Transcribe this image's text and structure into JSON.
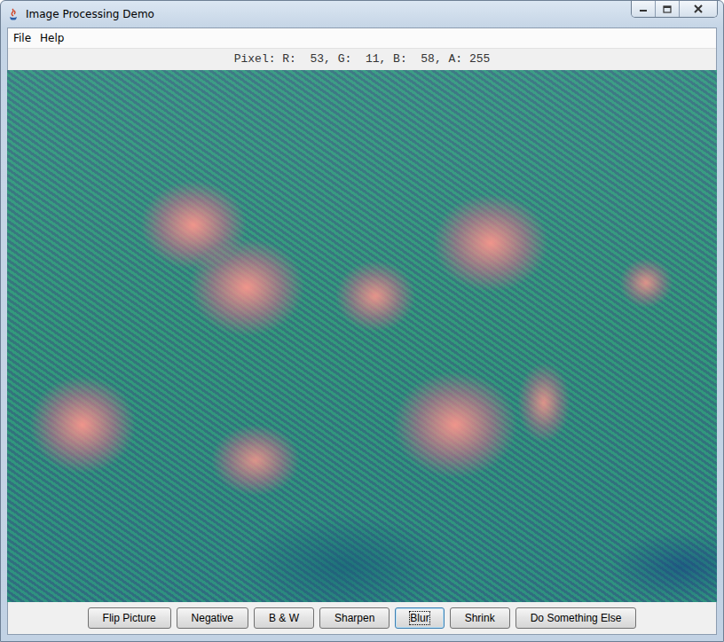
{
  "window": {
    "title": "Image Processing Demo"
  },
  "menu": [
    {
      "label": "File"
    },
    {
      "label": "Help"
    }
  ],
  "pixel_readout": "Pixel: R:  53, G:  11, B:  58, A: 255",
  "buttons": [
    {
      "label": "Flip Picture",
      "focused": false
    },
    {
      "label": "Negative",
      "focused": false
    },
    {
      "label": "B & W",
      "focused": false
    },
    {
      "label": "Sharpen",
      "focused": false
    },
    {
      "label": "Blur",
      "focused": true
    },
    {
      "label": "Shrink",
      "focused": false
    },
    {
      "label": "Do Something Else",
      "focused": false
    }
  ]
}
